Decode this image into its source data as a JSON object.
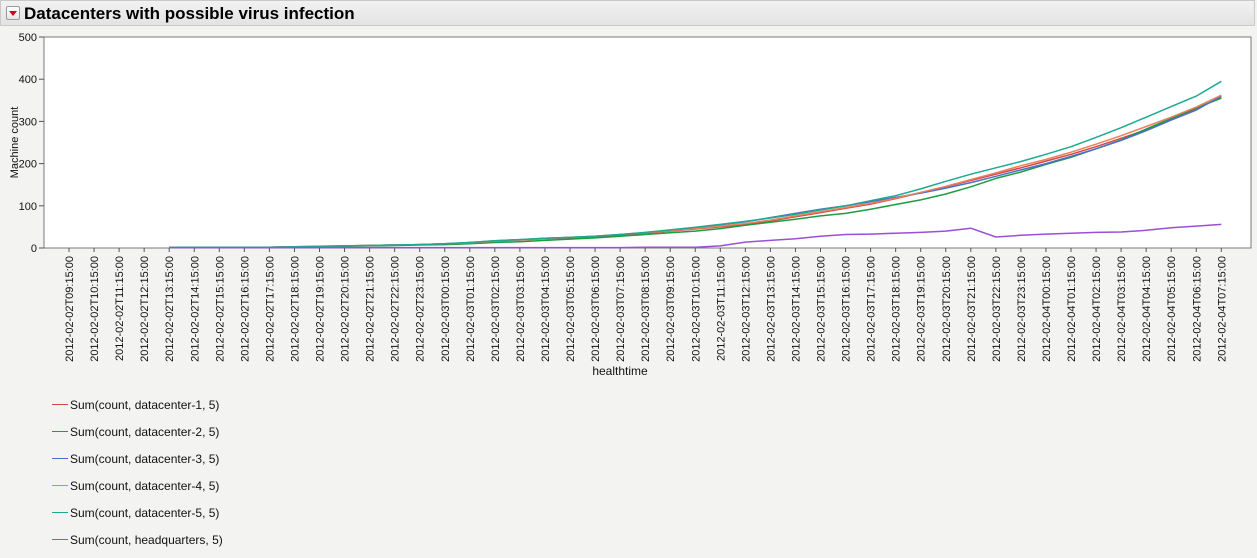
{
  "header": {
    "title": "Datacenters with possible virus infection",
    "disclosure_icon": "red-triangle-menu-icon"
  },
  "chart_data": {
    "type": "line",
    "xlabel": "healthtime",
    "ylabel": "Machine count",
    "ylim": [
      0,
      500
    ],
    "yticks": [
      0,
      100,
      200,
      300,
      400,
      500
    ],
    "grid": false,
    "legend_position": "bottom-left",
    "x": [
      "2012-02-02T09:15:00",
      "2012-02-02T10:15:00",
      "2012-02-02T11:15:00",
      "2012-02-02T12:15:00",
      "2012-02-02T13:15:00",
      "2012-02-02T14:15:00",
      "2012-02-02T15:15:00",
      "2012-02-02T16:15:00",
      "2012-02-02T17:15:00",
      "2012-02-02T18:15:00",
      "2012-02-02T19:15:00",
      "2012-02-02T20:15:00",
      "2012-02-02T21:15:00",
      "2012-02-02T22:15:00",
      "2012-02-02T23:15:00",
      "2012-02-03T00:15:00",
      "2012-02-03T01:15:00",
      "2012-02-03T02:15:00",
      "2012-02-03T03:15:00",
      "2012-02-03T04:15:00",
      "2012-02-03T05:15:00",
      "2012-02-03T06:15:00",
      "2012-02-03T07:15:00",
      "2012-02-03T08:15:00",
      "2012-02-03T09:15:00",
      "2012-02-03T10:15:00",
      "2012-02-03T11:15:00",
      "2012-02-03T12:15:00",
      "2012-02-03T13:15:00",
      "2012-02-03T14:15:00",
      "2012-02-03T15:15:00",
      "2012-02-03T16:15:00",
      "2012-02-03T17:15:00",
      "2012-02-03T18:15:00",
      "2012-02-03T19:15:00",
      "2012-02-03T20:15:00",
      "2012-02-03T21:15:00",
      "2012-02-03T22:15:00",
      "2012-02-03T23:15:00",
      "2012-02-04T00:15:00",
      "2012-02-04T01:15:00",
      "2012-02-04T02:15:00",
      "2012-02-04T03:15:00",
      "2012-02-04T04:15:00",
      "2012-02-04T05:15:00",
      "2012-02-04T06:15:00",
      "2012-02-04T07:15:00"
    ],
    "series": [
      {
        "name": "Sum(count, datacenter-1, 5)",
        "color": "#d3454b",
        "values": [
          null,
          null,
          null,
          null,
          2,
          2,
          2,
          2,
          2,
          3,
          3,
          5,
          6,
          7,
          8,
          10,
          12,
          16,
          19,
          22,
          24,
          27,
          30,
          35,
          40,
          45,
          50,
          56,
          64,
          74,
          84,
          94,
          104,
          117,
          131,
          145,
          160,
          175,
          190,
          206,
          222,
          240,
          260,
          280,
          305,
          330,
          357
        ]
      },
      {
        "name": "Sum(count, datacenter-2, 5)",
        "color": "#1e9c40",
        "values": [
          null,
          null,
          null,
          null,
          2,
          2,
          2,
          2,
          2,
          2,
          3,
          4,
          5,
          6,
          7,
          8,
          10,
          13,
          15,
          18,
          21,
          24,
          28,
          32,
          36,
          40,
          46,
          54,
          61,
          68,
          76,
          82,
          92,
          103,
          114,
          128,
          145,
          165,
          180,
          198,
          215,
          235,
          256,
          282,
          307,
          332,
          355
        ]
      },
      {
        "name": "Sum(count, datacenter-3, 5)",
        "color": "#4c70c8",
        "values": [
          null,
          null,
          null,
          null,
          2,
          2,
          2,
          2,
          2,
          3,
          3,
          5,
          6,
          7,
          8,
          10,
          13,
          17,
          20,
          23,
          25,
          28,
          32,
          36,
          42,
          48,
          55,
          62,
          72,
          82,
          92,
          100,
          110,
          120,
          130,
          142,
          155,
          170,
          185,
          200,
          217,
          235,
          255,
          278,
          303,
          327,
          360
        ]
      },
      {
        "name": "Sum(count, datacenter-4, 5)",
        "color": "#e8805a",
        "values": [
          null,
          null,
          null,
          null,
          2,
          2,
          2,
          2,
          2,
          3,
          4,
          5,
          6,
          7,
          8,
          10,
          12,
          16,
          19,
          22,
          25,
          28,
          32,
          36,
          41,
          46,
          52,
          58,
          66,
          76,
          86,
          96,
          106,
          118,
          132,
          146,
          162,
          178,
          195,
          210,
          227,
          246,
          266,
          288,
          310,
          334,
          362
        ]
      },
      {
        "name": "Sum(count, datacenter-5, 5)",
        "color": "#1ea88f",
        "values": [
          null,
          null,
          null,
          null,
          2,
          2,
          2,
          2,
          2,
          3,
          4,
          5,
          6,
          7,
          8,
          10,
          13,
          17,
          20,
          23,
          25,
          28,
          32,
          37,
          43,
          49,
          56,
          63,
          71,
          80,
          90,
          100,
          112,
          124,
          140,
          158,
          175,
          190,
          205,
          222,
          240,
          262,
          285,
          310,
          335,
          360,
          395
        ]
      },
      {
        "name": "Sum(count, headquarters, 5)",
        "color": "#9b4fd6",
        "values": [
          null,
          null,
          null,
          null,
          1,
          1,
          1,
          1,
          1,
          1,
          1,
          1,
          1,
          1,
          1,
          1,
          1,
          1,
          1,
          1,
          1,
          1,
          1,
          2,
          2,
          2,
          5,
          14,
          18,
          22,
          28,
          32,
          33,
          35,
          37,
          40,
          47,
          26,
          30,
          33,
          35,
          37,
          38,
          42,
          48,
          52,
          56
        ]
      }
    ]
  }
}
